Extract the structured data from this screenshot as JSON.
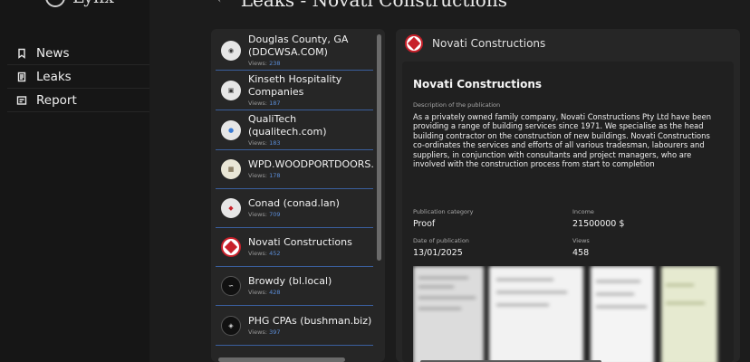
{
  "brand": {
    "name": "Lynx"
  },
  "nav": [
    {
      "label": "News",
      "icon": "bookmark-icon"
    },
    {
      "label": "Leaks",
      "icon": "document-icon"
    },
    {
      "label": "Report",
      "icon": "report-icon"
    }
  ],
  "page": {
    "title": "Leaks - Novati Constructions",
    "back_icon": "arrow-left-icon"
  },
  "list": {
    "views_label": "Views:",
    "items": [
      {
        "name": "Douglas County, GA (DDCWSA.COM)",
        "views": "238"
      },
      {
        "name": "Kinseth Hospitality Companies",
        "views": "187"
      },
      {
        "name": "QualiTech (qualitech.com)",
        "views": "183"
      },
      {
        "name": "WPD.WOODPORTDOORS.COM",
        "views": "178"
      },
      {
        "name": "Conad (conad.lan)",
        "views": "709"
      },
      {
        "name": "Novati Constructions",
        "views": "452"
      },
      {
        "name": "Browdy (bl.local)",
        "views": "428"
      },
      {
        "name": "PHG CPAs (bushman.biz)",
        "views": "397"
      }
    ]
  },
  "detail": {
    "header_name": "Novati Constructions",
    "title": "Novati Constructions",
    "description_label": "Description of the publication",
    "description": "As a privately owned family company, Novati Constructions Pty Ltd have been providing a range of building services since 1971. We specialise as the head building contractor on the construction of new buildings. Novati Constructions co-ordinates the services and efforts of all various tradesman, labourers and suppliers, in conjunction with consultants and project managers, who are involved with the construction process from start to completion",
    "category_label": "Publication category",
    "category": "Proof",
    "income_label": "Income",
    "income": "21500000 $",
    "date_label": "Date of publication",
    "date": "13/01/2025",
    "views_label": "Views",
    "views": "458"
  },
  "colors": {
    "accent": "#3a5f9e",
    "views_number": "#5b8cd6",
    "logo_red": "#c8202a"
  }
}
